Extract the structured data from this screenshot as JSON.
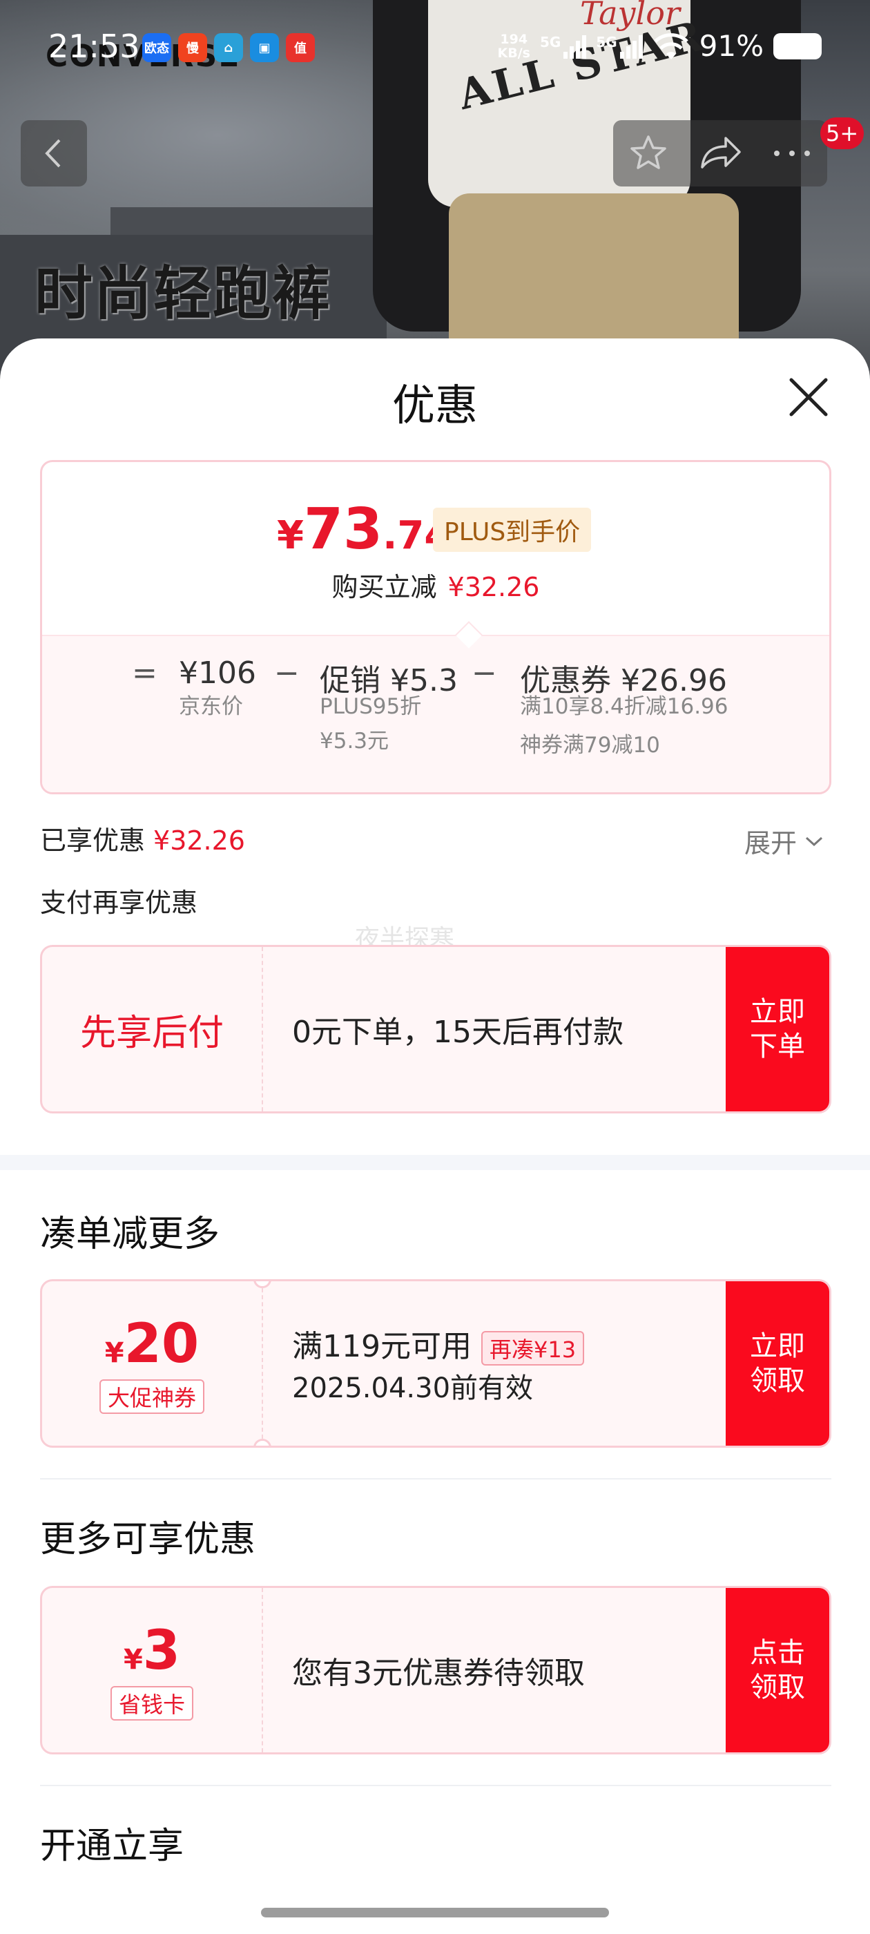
{
  "status_bar": {
    "time": "21:53",
    "apps": [
      {
        "name": "app-icon-1",
        "label": "欧态",
        "color": "#1b6ef3"
      },
      {
        "name": "app-icon-2",
        "label": "慢",
        "color": "#f0431f"
      },
      {
        "name": "app-icon-3",
        "label": "⌂",
        "color": "#2aa0d8"
      },
      {
        "name": "app-icon-4",
        "label": "▣",
        "color": "#1a8de0"
      },
      {
        "name": "app-icon-5",
        "label": "值",
        "color": "#e8322c"
      }
    ],
    "net_speed_value": "194",
    "net_speed_unit": "KB/s",
    "sig1": "5G",
    "sig2": "5G",
    "battery_pct": "91%"
  },
  "banner": {
    "brand": "CONVERSE",
    "shirt_text": "ALL STAR",
    "shirt_script": "Taylor",
    "slogan": "时尚轻跑裤"
  },
  "nav": {
    "badge": "5+"
  },
  "sheet": {
    "title": "优惠"
  },
  "price_card": {
    "yen": "¥",
    "price_int": "73",
    "price_dec": ".74",
    "plus_tag": "PLUS到手价",
    "instant_label": "购买立减",
    "instant_value": "¥32.26",
    "formula": {
      "eq": "=",
      "jd_value": "¥106",
      "jd_label": "京东价",
      "minus1": "−",
      "promo_value": "促销 ¥5.3",
      "promo_sub1": "PLUS95折",
      "promo_sub2": "¥5.3元",
      "minus2": "−",
      "coupon_value": "优惠券 ¥26.96",
      "coupon_sub1": "满10享8.4折减16.96",
      "coupon_sub2": "神券满79减10"
    }
  },
  "enjoyed": {
    "label": "已享优惠",
    "value": "¥32.26",
    "expand": "展开"
  },
  "pay_more": {
    "label": "支付再享优惠",
    "watermark": "夜半探寒",
    "card": {
      "left": "先享后付",
      "text": "0元下单，15天后再付款",
      "action": "立即\n下单"
    }
  },
  "bundle": {
    "title": "凑单减更多",
    "card": {
      "yen": "¥",
      "amount": "20",
      "tag": "大促神券",
      "line1": "满119元可用",
      "re_tag": "再凑¥13",
      "line2": "2025.04.30前有效",
      "action": "立即\n领取"
    }
  },
  "more": {
    "title": "更多可享优惠",
    "card": {
      "yen": "¥",
      "amount": "3",
      "tag": "省钱卡",
      "text": "您有3元优惠券待领取",
      "action": "点击\n领取"
    }
  },
  "open": {
    "title": "开通立享"
  },
  "colors": {
    "accent_red": "#e8172c",
    "button_red": "#fa0a1e",
    "card_border": "#f9cdd5",
    "card_bg": "#fff6f7"
  }
}
